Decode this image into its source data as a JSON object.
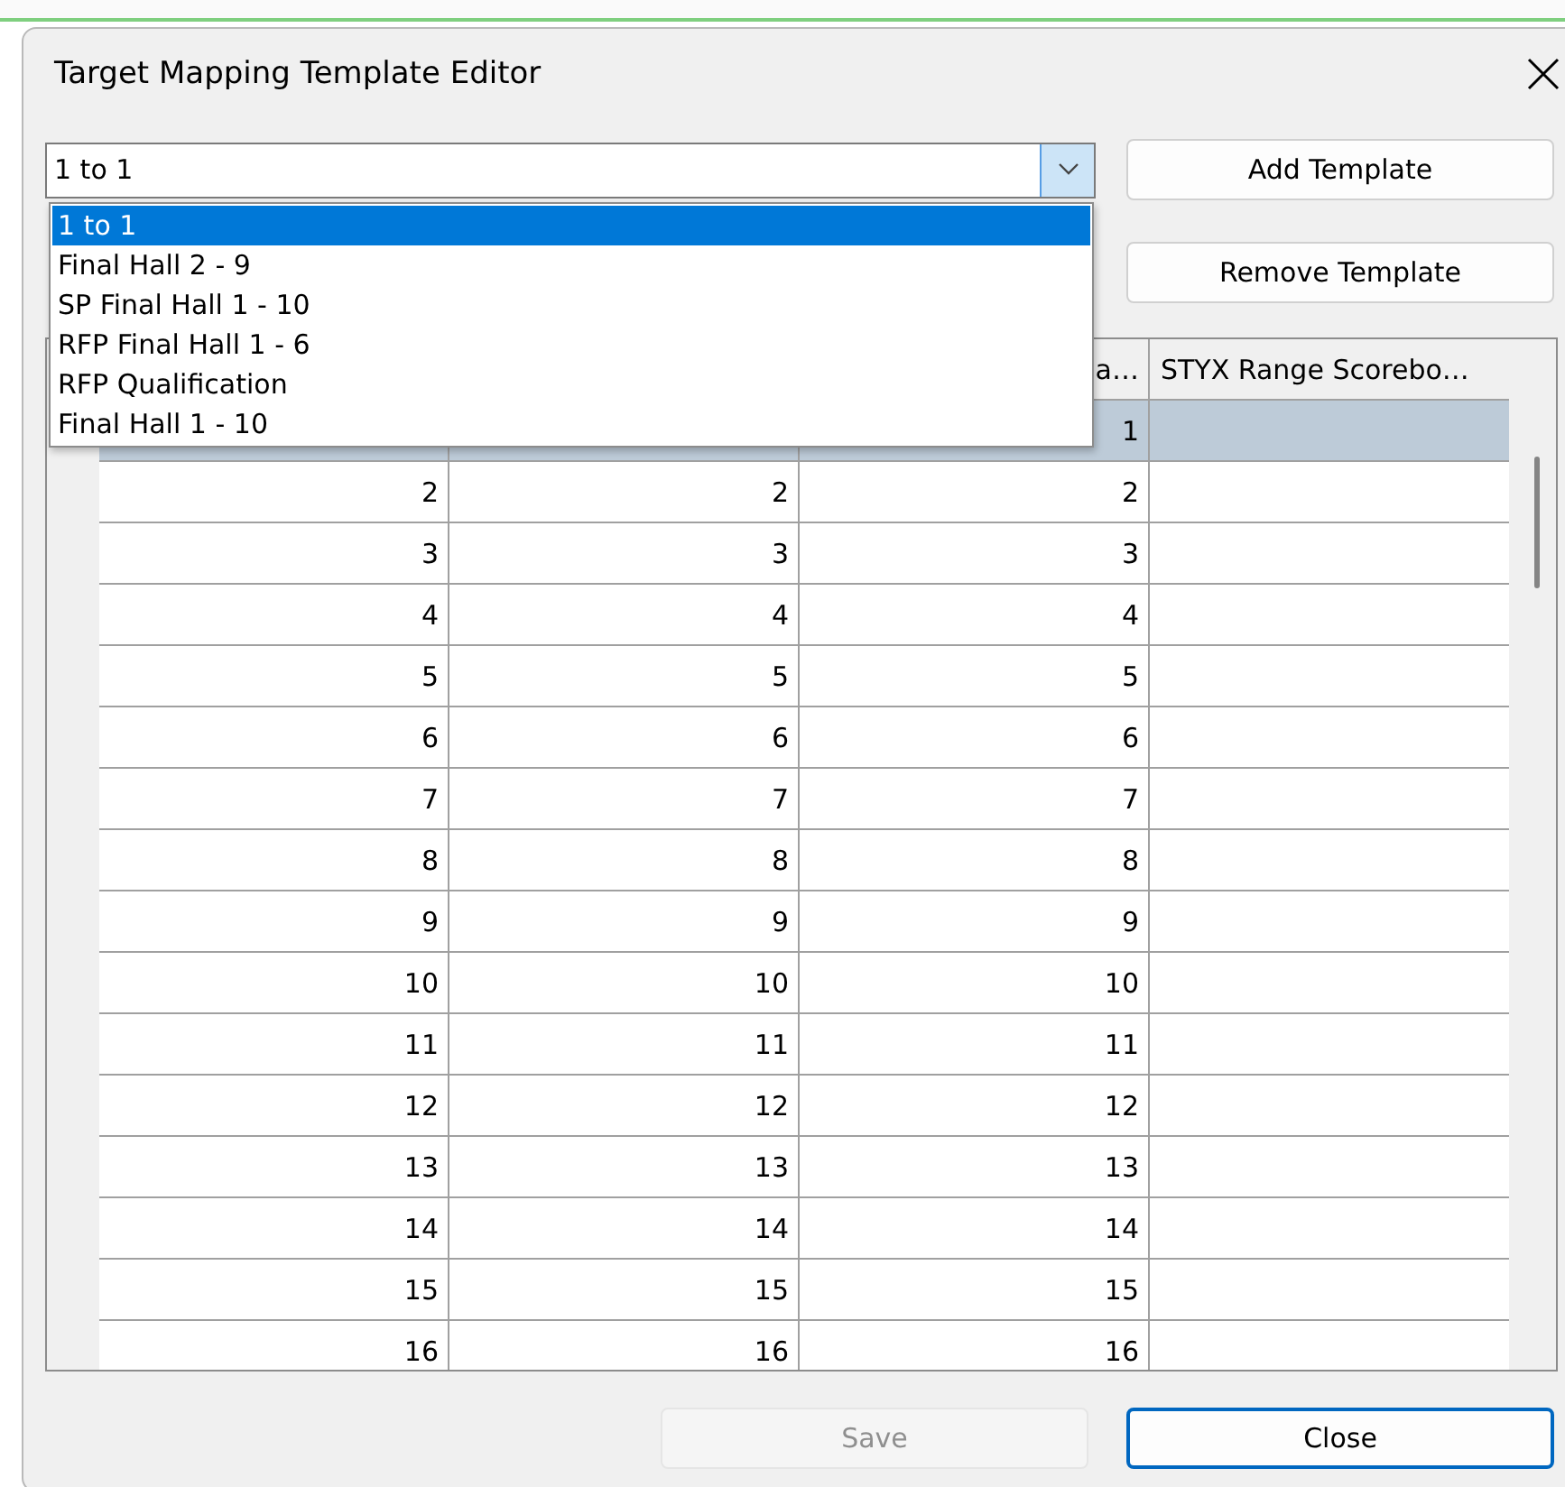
{
  "window": {
    "title": "Target Mapping Template Editor"
  },
  "template_combo": {
    "value": "1 to 1",
    "expanded": true
  },
  "dropdown": {
    "items": [
      {
        "label": "1 to 1",
        "selected": true
      },
      {
        "label": "Final Hall 2 - 9",
        "selected": false
      },
      {
        "label": "SP Final Hall 1 - 10",
        "selected": false
      },
      {
        "label": "RFP Final Hall 1 - 6",
        "selected": false
      },
      {
        "label": "RFP Qualification",
        "selected": false
      },
      {
        "label": "Final Hall 1 - 10",
        "selected": false
      }
    ]
  },
  "buttons": [
    {
      "label": "Add Template",
      "kind": "side",
      "disabled": false,
      "default": false
    },
    {
      "label": "Remove Template",
      "kind": "side",
      "disabled": false,
      "default": false
    },
    {
      "label": "Save",
      "kind": "footer",
      "disabled": true,
      "default": false
    },
    {
      "label": "Close",
      "kind": "footer",
      "disabled": false,
      "default": true
    }
  ],
  "table": {
    "headers": {
      "column_3": "a…",
      "column_4": "STYX Range Scorebo…"
    },
    "rows": [
      {
        "selected": true,
        "column_3": "1"
      },
      {
        "selected": false,
        "column_1": "2",
        "column_2": "2",
        "column_3": "2"
      },
      {
        "selected": false,
        "column_1": "3",
        "column_2": "3",
        "column_3": "3"
      },
      {
        "selected": false,
        "column_1": "4",
        "column_2": "4",
        "column_3": "4"
      },
      {
        "selected": false,
        "column_1": "5",
        "column_2": "5",
        "column_3": "5"
      },
      {
        "selected": false,
        "column_1": "6",
        "column_2": "6",
        "column_3": "6"
      },
      {
        "selected": false,
        "column_1": "7",
        "column_2": "7",
        "column_3": "7"
      },
      {
        "selected": false,
        "column_1": "8",
        "column_2": "8",
        "column_3": "8"
      },
      {
        "selected": false,
        "column_1": "9",
        "column_2": "9",
        "column_3": "9"
      },
      {
        "selected": false,
        "column_1": "10",
        "column_2": "10",
        "column_3": "10"
      },
      {
        "selected": false,
        "column_1": "11",
        "column_2": "11",
        "column_3": "11"
      },
      {
        "selected": false,
        "column_1": "12",
        "column_2": "12",
        "column_3": "12"
      },
      {
        "selected": false,
        "column_1": "13",
        "column_2": "13",
        "column_3": "13"
      },
      {
        "selected": false,
        "column_1": "14",
        "column_2": "14",
        "column_3": "14"
      },
      {
        "selected": false,
        "column_1": "15",
        "column_2": "15",
        "column_3": "15"
      },
      {
        "selected": false,
        "column_1": "16",
        "column_2": "16",
        "column_3": "16"
      }
    ]
  }
}
